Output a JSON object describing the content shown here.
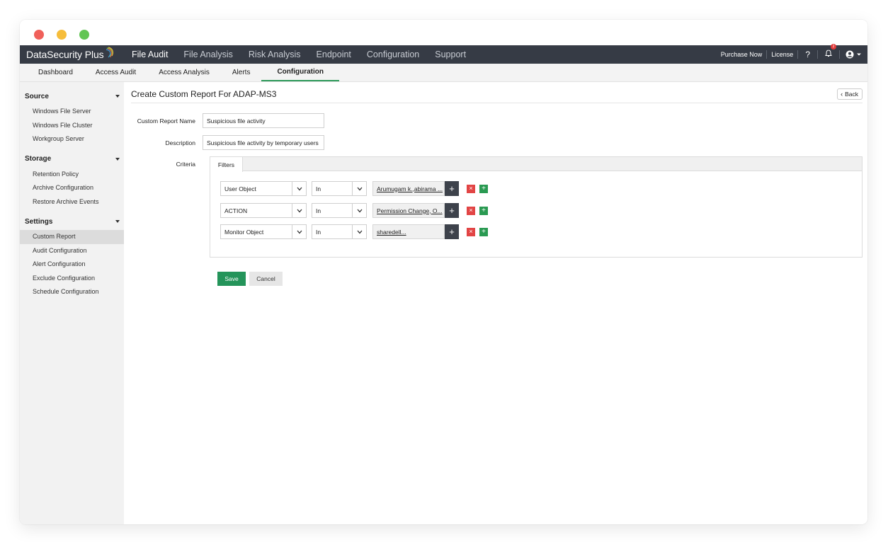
{
  "brand": {
    "name": "DataSecurity Plus"
  },
  "top_menu": [
    {
      "label": "File Audit"
    },
    {
      "label": "File Analysis"
    },
    {
      "label": "Risk Analysis"
    },
    {
      "label": "Endpoint"
    },
    {
      "label": "Configuration"
    },
    {
      "label": "Support"
    }
  ],
  "top_right": {
    "purchase": "Purchase Now",
    "license": "License",
    "help": "?",
    "notif_count": "2"
  },
  "sub_menu": [
    {
      "label": "Dashboard"
    },
    {
      "label": "Access Audit"
    },
    {
      "label": "Access Analysis"
    },
    {
      "label": "Alerts"
    },
    {
      "label": "Configuration"
    }
  ],
  "sidebar": {
    "sections": [
      {
        "title": "Source",
        "items": [
          "Windows File Server",
          "Windows File Cluster",
          "Workgroup Server"
        ]
      },
      {
        "title": "Storage",
        "items": [
          "Retention Policy",
          "Archive Configuration",
          "Restore Archive Events"
        ]
      },
      {
        "title": "Settings",
        "items": [
          "Custom Report",
          "Audit Configuration",
          "Alert Configuration",
          "Exclude Configuration",
          "Schedule Configuration"
        ]
      }
    ]
  },
  "page": {
    "title": "Create Custom Report For ADAP-MS3",
    "back_label": "Back",
    "report_name_label": "Custom Report Name",
    "report_name_value": "Suspicious file activity",
    "description_label": "Description",
    "description_value": "Suspicious file activity by temporary users",
    "criteria_label": "Criteria",
    "filters_tab": "Filters",
    "filters": [
      {
        "field": "User Object",
        "operator": "In",
        "value": "Arumugam k.,abirama ..."
      },
      {
        "field": "ACTION",
        "operator": "In",
        "value": "Permission Change, O..."
      },
      {
        "field": "Monitor Object",
        "operator": "In",
        "value": "sharedell..."
      }
    ],
    "save_label": "Save",
    "cancel_label": "Cancel"
  },
  "colors": {
    "nav_bg": "#363b45",
    "accent_green": "#24945a",
    "remove_red": "#e24545"
  }
}
